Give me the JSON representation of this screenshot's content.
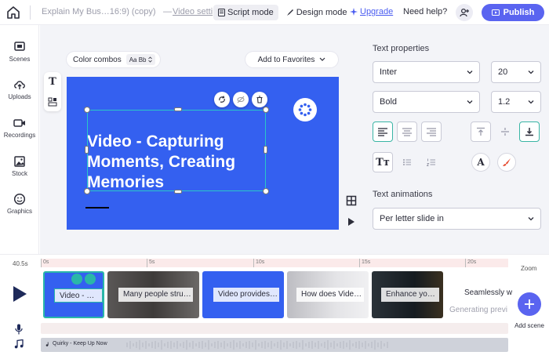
{
  "topbar": {
    "project_title": "Explain My Bus…16:9) (copy)",
    "title_separator": "—",
    "video_settings": "Video setti",
    "modes": [
      {
        "label": "Script mode",
        "icon": "script-mode-icon",
        "active": true
      },
      {
        "label": "Design mode",
        "icon": "design-mode-icon",
        "active": false
      }
    ],
    "upgrade_label": "Upgrade",
    "help_label": "Need help?",
    "publish_label": "Publish"
  },
  "sidebar": {
    "items": [
      {
        "label": "Scenes",
        "icon": "scenes-icon"
      },
      {
        "label": "Uploads",
        "icon": "upload-icon"
      },
      {
        "label": "Recordings",
        "icon": "video-camera-icon"
      },
      {
        "label": "Stock",
        "icon": "image-icon"
      },
      {
        "label": "Graphics",
        "icon": "smiley-icon"
      }
    ]
  },
  "canvas": {
    "color_combos_label": "Color combos",
    "combo_chip": "Aa Bb",
    "favorites_label": "Add to Favorites",
    "slide_title": "Video - Capturing Moments, Creating Memories",
    "slide_bg": "#3460f0",
    "selection_color": "#29c7c7"
  },
  "panel": {
    "text_properties_heading": "Text properties",
    "font_family": "Inter",
    "font_size": "20",
    "font_weight": "Bold",
    "line_height": "1.2",
    "text_animations_heading": "Text animations",
    "animation": "Per letter slide in"
  },
  "timeline": {
    "total_time": "40.5s",
    "ticks": [
      "0s",
      "5s",
      "10s",
      "15s",
      "20s"
    ],
    "clips": [
      {
        "label": "Video - …",
        "bg": "#3460f0"
      },
      {
        "label": "Many people stru…",
        "bg": "#4a4746"
      },
      {
        "label": "Video provides…",
        "bg": "#3460f0"
      },
      {
        "label": "How does Vide…",
        "bg": "#d9d9dc"
      },
      {
        "label": "Enhance yo…",
        "bg": "#1f2a30"
      }
    ],
    "generating_clip_title": "Seamlessly w",
    "generating_status": "Generating previ",
    "audio_label": "Quirky - Keep Up Now",
    "zoom_label": "Zoom",
    "add_scene_label": "Add scene"
  },
  "colors": {
    "accent": "#5a64f0",
    "teal": "#2ab7a8"
  }
}
